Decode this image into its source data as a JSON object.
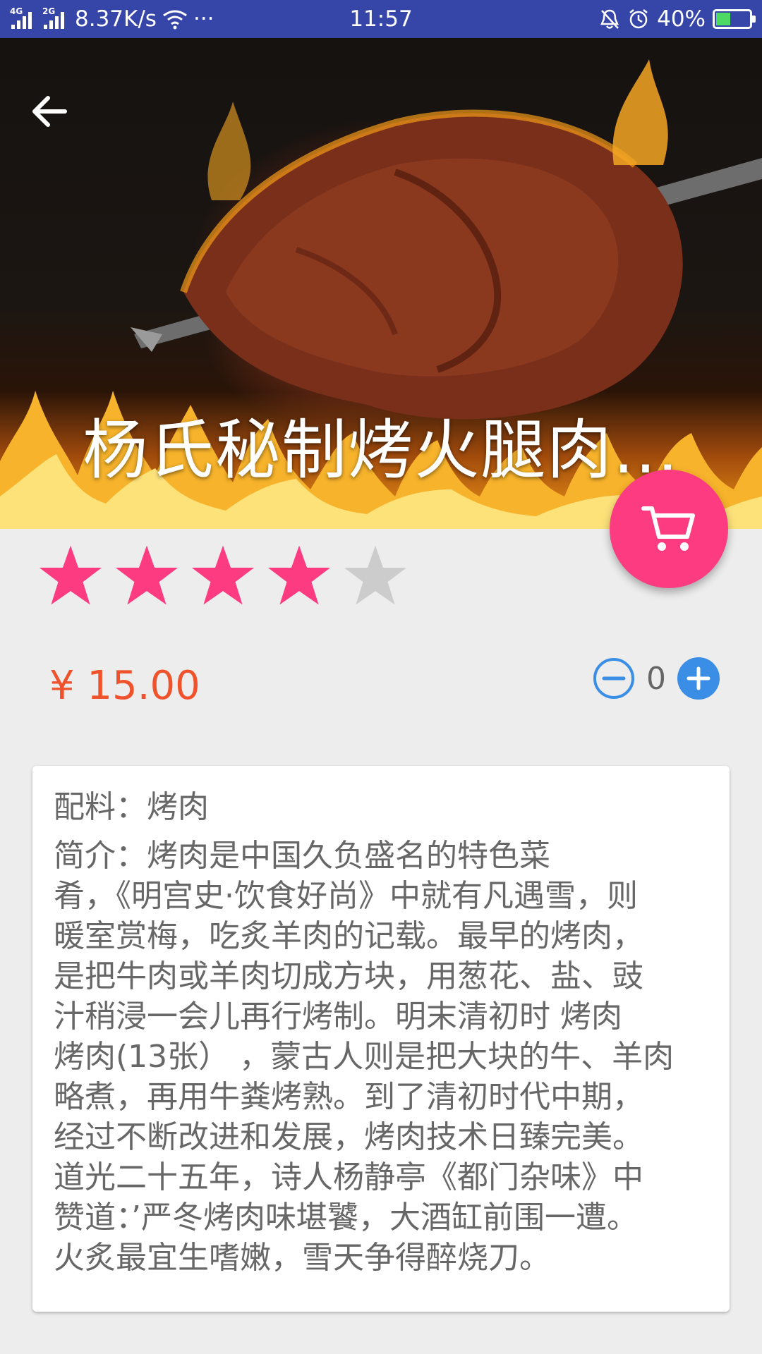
{
  "status_bar": {
    "network1": "4G",
    "network2": "2G",
    "speed": "8.37K/s",
    "more": "···",
    "time": "11:57",
    "battery": "40%",
    "battery_level": 0.4,
    "icons": [
      "signal-icon",
      "wifi-icon",
      "bell-muted-icon",
      "alarm-icon",
      "battery-icon"
    ]
  },
  "hero": {
    "title": "杨氏秘制烤火腿肉...",
    "back_icon": "arrow-left-icon"
  },
  "cart_button": {
    "icon": "shopping-cart-icon",
    "color": "#fc3b81"
  },
  "rating": {
    "value": 4,
    "max": 5,
    "active_color": "#fc3b81",
    "inactive_color": "#cccccc"
  },
  "price": {
    "text": "¥ 15.00",
    "color": "#f0522c"
  },
  "quantity": {
    "value": "0",
    "minus_icon": "minus-circle-icon",
    "plus_icon": "plus-circle-icon",
    "accent": "#3a8ee6"
  },
  "details": {
    "ingredients": "配料：烤肉",
    "description_lines": [
      "简介：烤肉是中国久负盛名的特色菜",
      "肴，《明宫史·饮食好尚》中就有凡遇雪，则",
      "暖室赏梅，吃炙羊肉的记载。最早的烤肉，",
      "是把牛肉或羊肉切成方块，用葱花、盐、豉",
      "汁稍浸一会儿再行烤制。明末清初时 烤肉",
      "烤肉(13张） ，蒙古人则是把大块的牛、羊肉",
      "略煮，再用牛粪烤熟。到了清初时代中期，",
      "经过不断改进和发展，烤肉技术日臻完美。",
      "道光二十五年，诗人杨静亭《都门杂味》中",
      "赞道：’严冬烤肉味堪饕，大酒缸前围一遭。",
      "火炙最宜生嗜嫩，雪天争得醉烧刀。"
    ]
  }
}
